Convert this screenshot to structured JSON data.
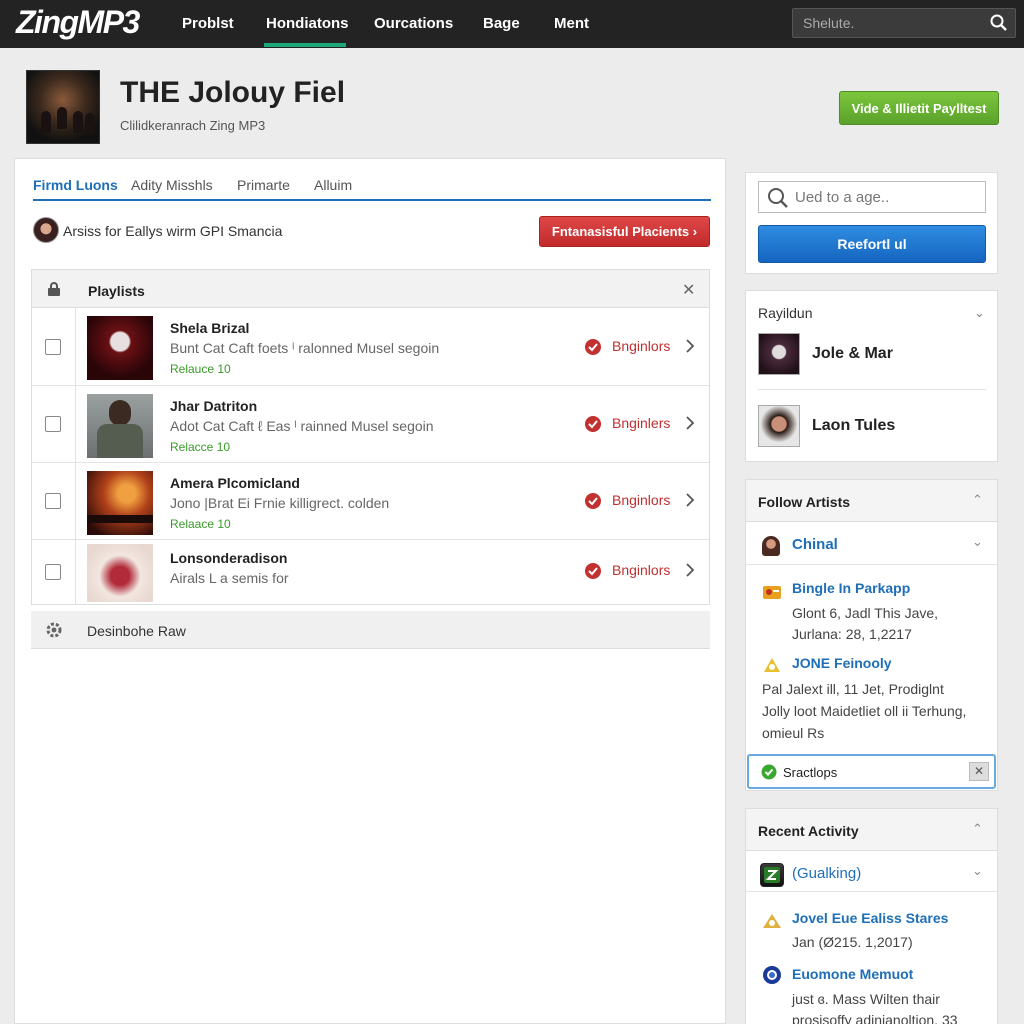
{
  "app": {
    "logo": "ZingMP3"
  },
  "nav": {
    "items": [
      "Problst",
      "Hondiatons",
      "Ourcations",
      "Bage",
      "Ment"
    ],
    "search_placeholder": "Shelute."
  },
  "header": {
    "title": "THE Jolouy Fiel",
    "subtitle": "Clilidkeranrach Zing MP3",
    "cta": "Vide & Illietit Paylltest"
  },
  "tabs": [
    "Firmd Luons",
    "Adity Misshls",
    "Primarte",
    "Alluim"
  ],
  "artist_line": "Arsiss for Eallys wirm GPI Smancia",
  "red_button": "Fntanasisful Placients  ›",
  "playlists": {
    "title": "Playlists",
    "rows": [
      {
        "title": "Shela Brizal",
        "desc": "Bunt Cat Caft foets ˡ ralonned Musel segoin",
        "meta": "Relauce 10",
        "status": "Bnginlors"
      },
      {
        "title": "Jhar Datriton",
        "desc": "Adot Cat Caft ℓ Eas ˡ rainned Musel segoin",
        "meta": "Relacce 10",
        "status": "Bnginlers"
      },
      {
        "title": "Amera Plcomicland",
        "desc": "Jono |Brat Ei Frnie killigrect. colden",
        "meta": "Relaace 10",
        "status": "Bnginlors"
      },
      {
        "title": "Lonsonderadison",
        "desc": "Airals L a semis for",
        "meta": "",
        "status": "Bnginlors"
      }
    ],
    "footer": "Desinbohe Raw"
  },
  "right": {
    "search_placeholder": "Ued to a age..",
    "blue_button": "Reefortl ul",
    "rayildun": {
      "title": "Rayildun",
      "people": [
        "Jole & Mar",
        "Laon Tules"
      ]
    },
    "follow": {
      "title": "Follow Artists",
      "lead": "Chinal",
      "items": [
        {
          "title": "Bingle In Parkapp",
          "lines": [
            "Glont 6, Jadl This Jave,",
            "Jurlana: 28, 1,2217"
          ]
        },
        {
          "title": "JONE Feinooly",
          "lines": [
            "Pal   Jalext ill, 11 Jet, Prodiglnt",
            "Jolly loot Maidetliet oll ii Terhung,",
            "omieul Rs"
          ]
        }
      ],
      "chip": "Sractlops",
      "chip_close": "✕"
    },
    "recent": {
      "title": "Recent Activity",
      "lead": "(Gualking)",
      "items": [
        {
          "title": "Jovel Eue Ealiss Stares",
          "lines": [
            "Jan (Ø215. 1,2017)"
          ]
        },
        {
          "title": "Euomone Memuot",
          "lines": [
            "just ɞ. Mass Wilten thair",
            "prosisoffy adinianoltion, 33"
          ]
        }
      ]
    }
  },
  "colors": {
    "topbar": "#232323",
    "accent_green": "#5aa22a",
    "accent_red": "#c02a2a",
    "accent_blue": "#1565c0",
    "link_blue": "#1f6fb8",
    "meta_green": "#3a9a2a"
  },
  "icons": [
    "search-icon",
    "lock-icon",
    "close-icon",
    "chevron-right-icon",
    "chevron-down-icon",
    "chevron-up-icon",
    "status-dot-icon",
    "gear-icon",
    "check-icon"
  ]
}
